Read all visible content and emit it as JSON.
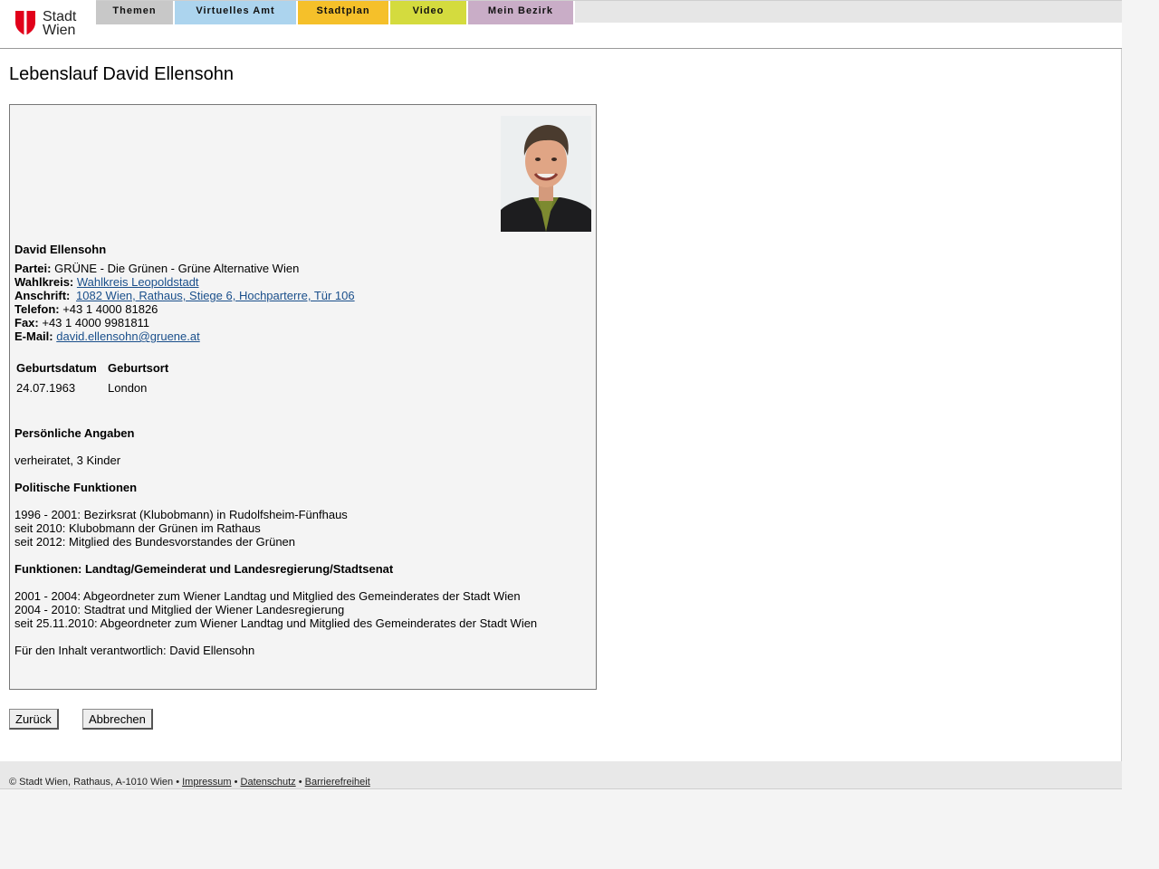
{
  "header": {
    "logo_line1": "Stadt",
    "logo_line2": "Wien",
    "tabs": [
      {
        "label": "Themen",
        "color": "#c8c8c8"
      },
      {
        "label": "Virtuelles Amt",
        "color": "#acd4ee"
      },
      {
        "label": "Stadtplan",
        "color": "#f5c02a"
      },
      {
        "label": "Video",
        "color": "#d4db3e"
      },
      {
        "label": "Mein Bezirk",
        "color": "#c9adc7"
      }
    ]
  },
  "page_title": "Lebenslauf David Ellensohn",
  "profile": {
    "name": "David Ellensohn",
    "partei_label": "Partei:",
    "partei_value": "GRÜNE - Die Grünen - Grüne Alternative Wien",
    "wahlkreis_label": "Wahlkreis:",
    "wahlkreis_value": "Wahlkreis Leopoldstadt",
    "anschrift_label": "Anschrift:",
    "anschrift_value": "1082 Wien, Rathaus, Stiege 6, Hochparterre, Tür 106",
    "telefon_label": "Telefon:",
    "telefon_value": "+43 1 4000 81826",
    "fax_label": "Fax:",
    "fax_value": "+43 1 4000 9981811",
    "email_label": "E-Mail:",
    "email_value": "david.ellensohn@gruene.at"
  },
  "birth_table": {
    "headers": [
      "Geburtsdatum",
      "Geburtsort"
    ],
    "row": [
      "24.07.1963",
      "London"
    ]
  },
  "sections": {
    "personal_heading": "Persönliche Angaben",
    "personal_text": "verheiratet, 3 Kinder",
    "political_heading": "Politische Funktionen",
    "political_lines": [
      "1996 - 2001: Bezirksrat (Klubobmann) in Rudolfsheim-Fünfhaus",
      "seit 2010: Klubobmann der Grünen im Rathaus",
      "seit 2012: Mitglied des Bundesvorstandes der Grünen"
    ],
    "functions_heading": "Funktionen: Landtag/Gemeinderat und Landesregierung/Stadtsenat",
    "functions_lines": [
      "2001 - 2004: Abgeordneter zum Wiener Landtag und Mitglied des Gemeinderates der Stadt Wien",
      "2004 - 2010: Stadtrat und Mitglied der Wiener Landesregierung",
      "seit 25.11.2010: Abgeordneter zum Wiener Landtag und Mitglied des Gemeinderates der Stadt Wien"
    ],
    "responsible": "Für den Inhalt verantwortlich: David Ellensohn"
  },
  "buttons": {
    "back": "Zurück",
    "cancel": "Abbrechen"
  },
  "footer": {
    "copyright": "© Stadt Wien, Rathaus, A-1010 Wien •",
    "impressum": "Impressum",
    "sep1": "•",
    "datenschutz": "Datenschutz",
    "sep2": "•",
    "barrierefreiheit": "Barrierefreiheit"
  }
}
